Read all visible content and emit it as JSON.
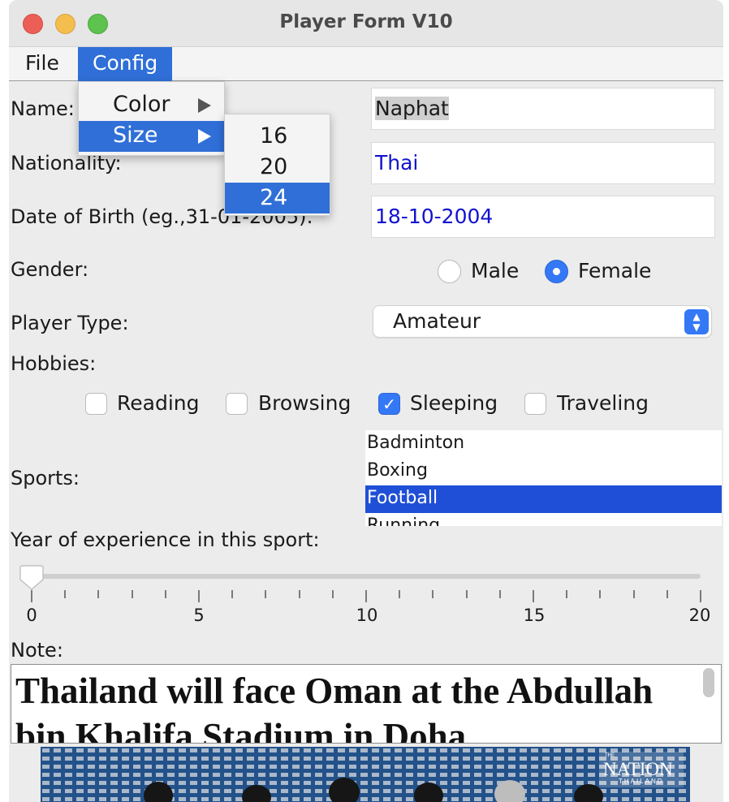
{
  "window": {
    "title": "Player Form V10"
  },
  "menubar": {
    "file": "File",
    "config": "Config"
  },
  "config_menu": {
    "items": [
      {
        "label": "Color"
      },
      {
        "label": "Size"
      }
    ]
  },
  "size_submenu": {
    "items": [
      "16",
      "20",
      "24"
    ],
    "selected": "24"
  },
  "form": {
    "name_label": "Name:",
    "name_value": "Naphat",
    "nationality_label": "Nationality:",
    "nationality_value": "Thai",
    "dob_label": "Date of Birth (eg.,31-01-2005):",
    "dob_value": "18-10-2004",
    "gender_label": "Gender:",
    "gender_options": [
      "Male",
      "Female"
    ],
    "gender_selected": "Female",
    "player_type_label": "Player Type:",
    "player_type_value": "Amateur",
    "hobbies_label": "Hobbies:",
    "hobbies": [
      {
        "label": "Reading",
        "checked": false
      },
      {
        "label": "Browsing",
        "checked": false
      },
      {
        "label": "Sleeping",
        "checked": true
      },
      {
        "label": "Traveling",
        "checked": false
      }
    ],
    "sports_label": "Sports:",
    "sports": [
      "Badminton",
      "Boxing",
      "Football",
      "Running"
    ],
    "sports_selected": "Football",
    "experience_label": "Year of experience in this sport:",
    "slider": {
      "min": 0,
      "max": 20,
      "value": 0,
      "major_labels": [
        "0",
        "5",
        "10",
        "15",
        "20"
      ]
    },
    "note_label": "Note:",
    "note_text": "Thailand will face Oman at the Abdullah bin Khalifa Stadium in Doha.",
    "photo_watermark": {
      "main": "NATION",
      "sub": "THAILAND",
      "top": "THE"
    }
  },
  "colors": {
    "accent": "#2f6fd7",
    "list_selection": "#1f4fd6",
    "field_text_blue": "#1212d0",
    "checkbox_blue": "#3478f6"
  },
  "icons": {
    "submenu": "triangle-right-icon",
    "combo": "up-down-chevron-icon",
    "check": "checkmark-icon"
  }
}
